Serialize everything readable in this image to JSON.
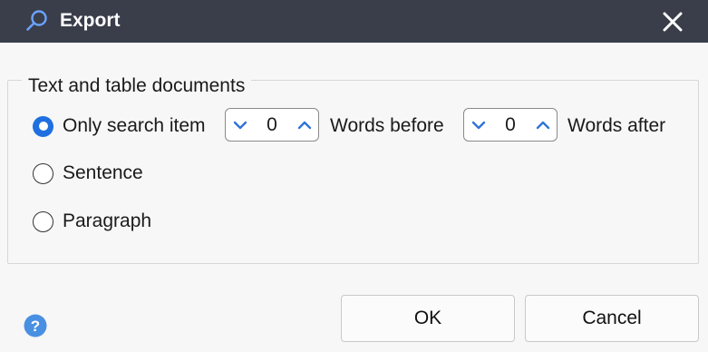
{
  "dialog": {
    "title": "Export",
    "title_icon": "search-icon",
    "close_icon": "close-icon"
  },
  "group": {
    "legend": "Text and table documents",
    "options": [
      {
        "label": "Only search item",
        "checked": true
      },
      {
        "label": "Sentence",
        "checked": false
      },
      {
        "label": "Paragraph",
        "checked": false
      }
    ],
    "words_before": {
      "value": "0",
      "label": "Words before"
    },
    "words_after": {
      "value": "0",
      "label": "Words after"
    }
  },
  "buttons": {
    "ok": "OK",
    "cancel": "Cancel"
  },
  "help_icon": "help-icon",
  "colors": {
    "titlebar": "#3a3e4a",
    "accent": "#1f6fe0",
    "icon_blue": "#6aa3ff",
    "help_blue": "#4a90e2"
  }
}
